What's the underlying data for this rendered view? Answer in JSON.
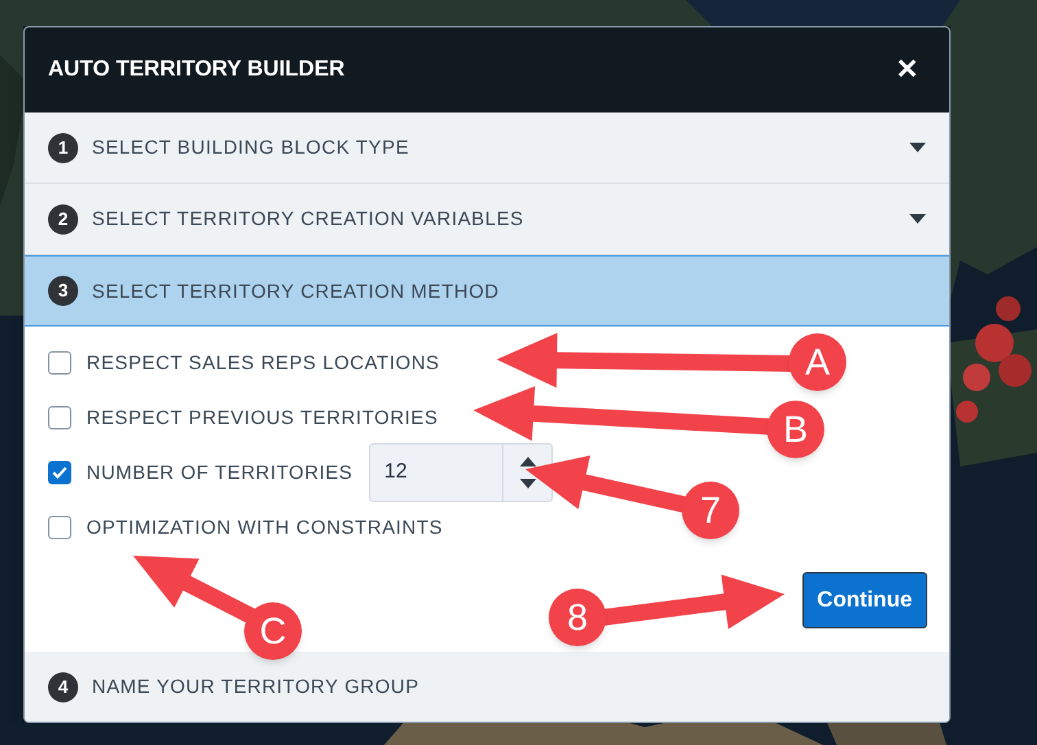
{
  "dialog": {
    "title": "AUTO TERRITORY BUILDER",
    "close": "✕"
  },
  "sections": [
    {
      "number": "1",
      "title": "SELECT BUILDING BLOCK TYPE",
      "selected": false,
      "collapsible": true
    },
    {
      "number": "2",
      "title": "SELECT TERRITORY CREATION VARIABLES",
      "selected": false,
      "collapsible": true
    },
    {
      "number": "3",
      "title": "SELECT TERRITORY CREATION METHOD",
      "selected": true,
      "collapsible": false
    }
  ],
  "options": [
    {
      "kind": "checkbox",
      "label": "RESPECT SALES REPS LOCATIONS",
      "checked": false
    },
    {
      "kind": "checkbox",
      "label": "RESPECT PREVIOUS TERRITORIES",
      "checked": false
    },
    {
      "kind": "number",
      "label": "NUMBER OF TERRITORIES",
      "checked": true,
      "value": "12"
    },
    {
      "kind": "checkbox",
      "label": "OPTIMIZATION WITH CONSTRAINTS",
      "checked": false
    }
  ],
  "continue_button": "Continue",
  "last_section": {
    "number": "4",
    "title": "NAME YOUR TERRITORY GROUP",
    "selected": false,
    "collapsible": false
  },
  "annotations": [
    "A",
    "B",
    "7",
    "C",
    "8"
  ]
}
